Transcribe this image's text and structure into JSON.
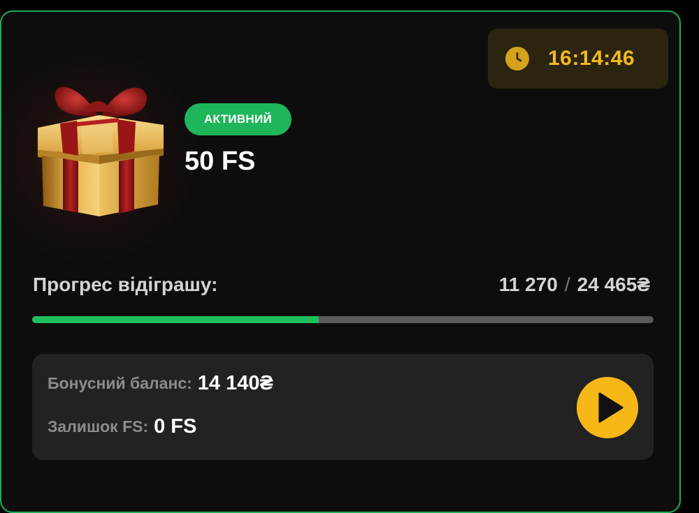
{
  "timer": {
    "icon": "clock-icon",
    "value": "16:14:46",
    "color": "#f2b91f"
  },
  "bonus": {
    "status": "АКТИВНИЙ",
    "title": "50 FS",
    "image": "gift-box-icon"
  },
  "progress": {
    "label": "Прогрес відіграшу:",
    "current": "11 270",
    "separator": "/",
    "total": "24 465₴",
    "fraction": 0.4607,
    "fill_color": "#1fbf5e",
    "track_color": "#5a5a5a"
  },
  "balance": {
    "bonus_label": "Бонусний баланс:",
    "bonus_value": "14 140₴",
    "fs_label": "Залишок FS:",
    "fs_value": "0 FS"
  },
  "actions": {
    "play_icon": "play-icon",
    "play_color": "#f5b817"
  },
  "colors": {
    "accent_green": "#1fb65b",
    "border_green": "#1fae5a",
    "background": "#0d0d0e"
  }
}
